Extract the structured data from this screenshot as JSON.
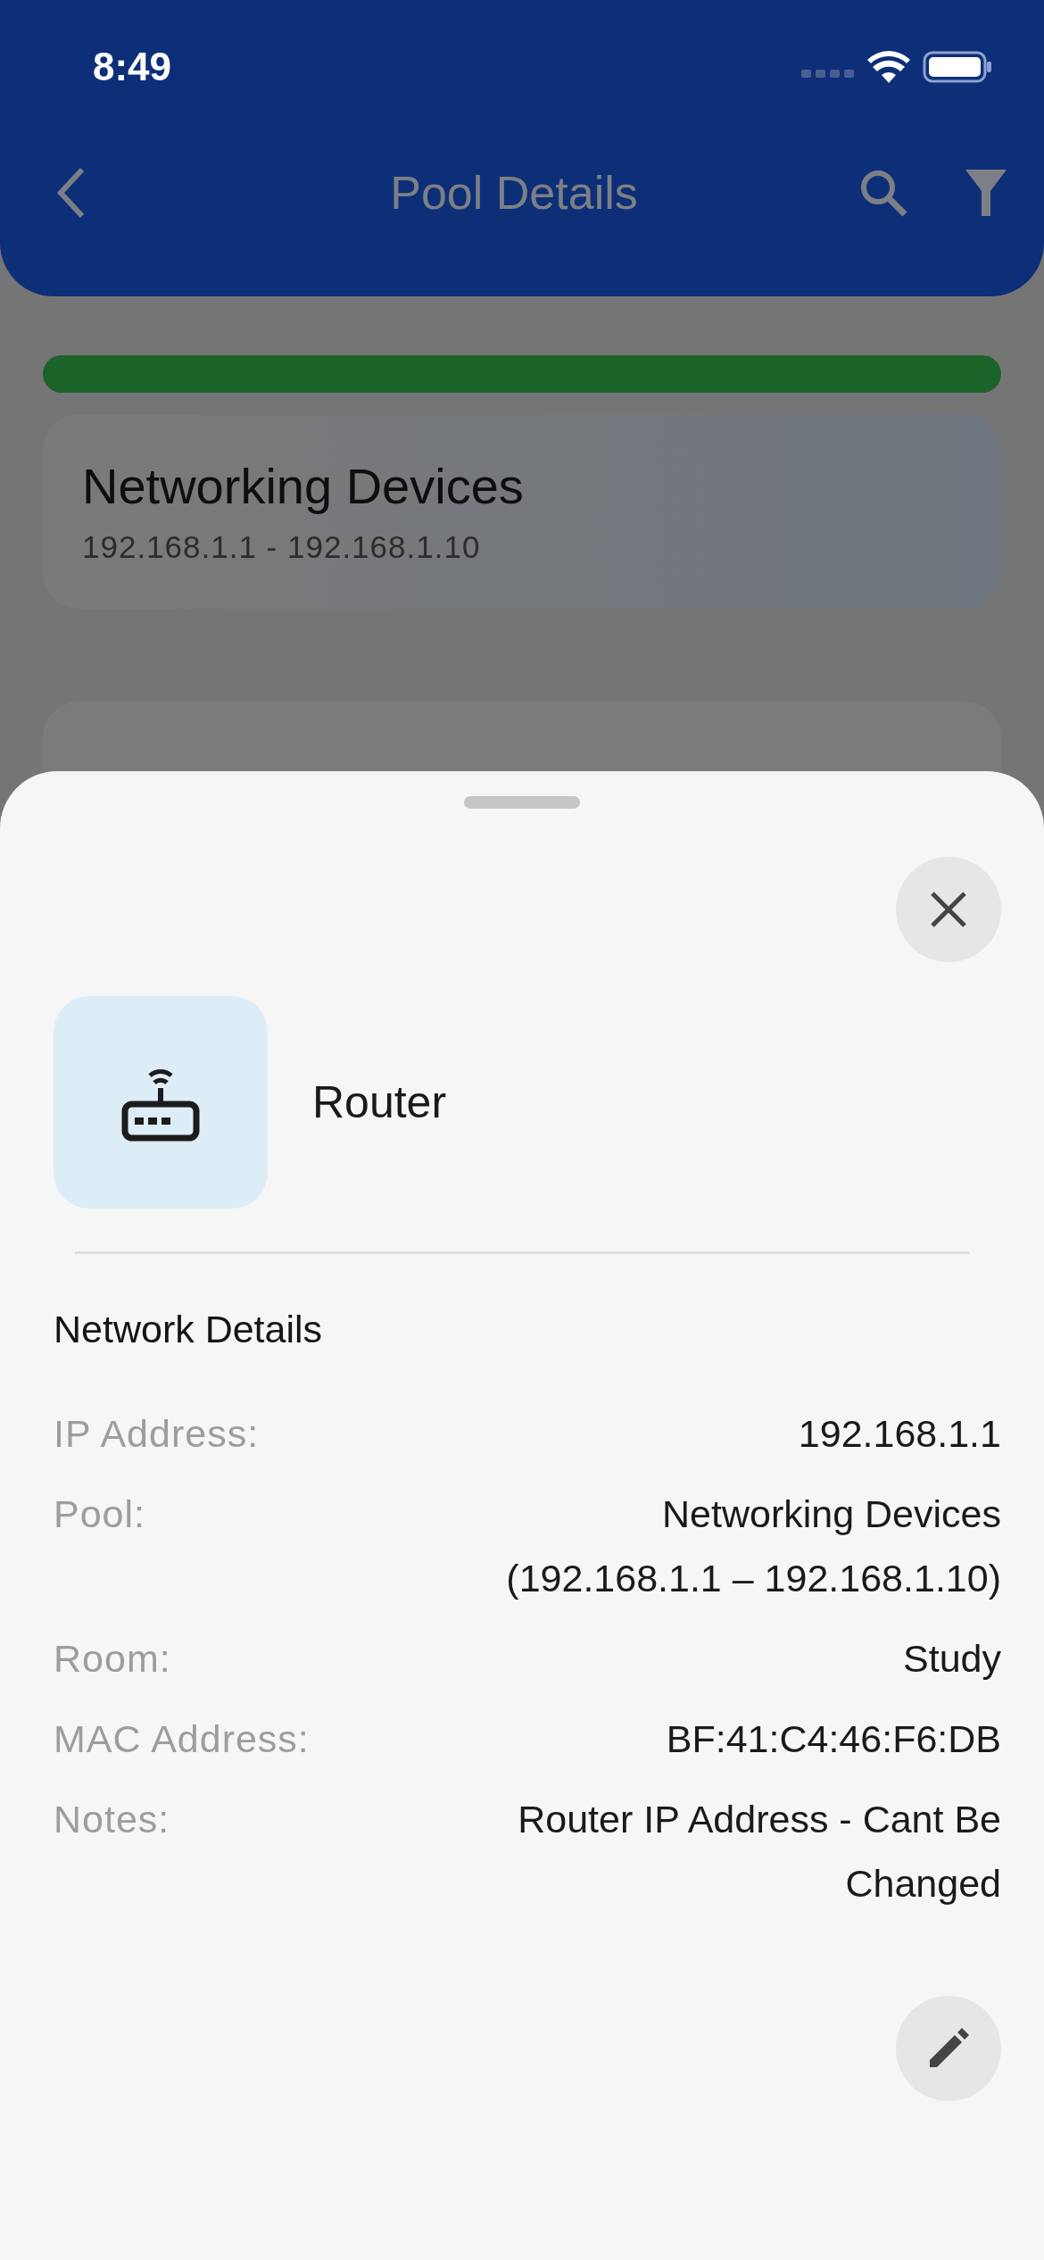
{
  "status_bar": {
    "time": "8:49"
  },
  "header": {
    "title": "Pool Details"
  },
  "pool": {
    "level": 1,
    "name": "Networking Devices",
    "range": "192.168.1.1 - 192.168.1.10"
  },
  "sheet": {
    "device_name": "Router",
    "section_title": "Network Details",
    "details": [
      {
        "label": "IP Address:",
        "value": "192.168.1.1"
      },
      {
        "label": "Pool:",
        "value": "Networking Devices (192.168.1.1 – 192.168.1.10)"
      },
      {
        "label": "Room:",
        "value": "Study"
      },
      {
        "label": "MAC Address:",
        "value": "BF:41:C4:46:F6:DB"
      },
      {
        "label": "Notes:",
        "value": "Router IP Address - Cant Be Changed"
      }
    ]
  }
}
